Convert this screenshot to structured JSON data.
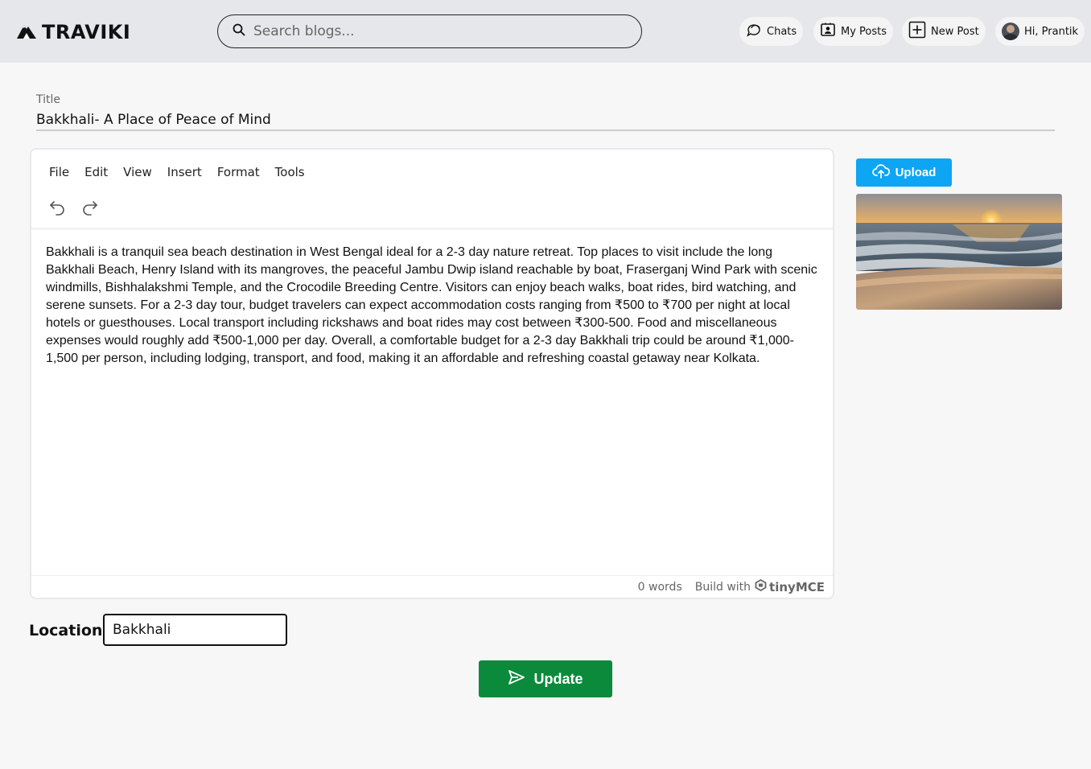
{
  "header": {
    "logo_text": "TRAVIKI",
    "search_placeholder": "Search blogs...",
    "nav": {
      "chats": "Chats",
      "my_posts": "My Posts",
      "new_post": "New Post",
      "greeting": "Hi, Prantik"
    }
  },
  "form": {
    "title_label": "Title",
    "title_value": "Bakkhali- A Place of Peace of Mind",
    "location_label": "Location:",
    "location_value": "Bakkhali",
    "upload_label": "Upload",
    "update_label": "Update"
  },
  "editor": {
    "menu": [
      "File",
      "Edit",
      "View",
      "Insert",
      "Format",
      "Tools"
    ],
    "content": "Bakkhali is a tranquil sea beach destination in West Bengal ideal for a 2-3 day nature retreat. Top places to visit include the long Bakkhali Beach, Henry Island with its mangroves, the peaceful Jambu Dwip island reachable by boat, Fraserganj Wind Park with scenic windmills, Bishhalakshmi Temple, and the Crocodile Breeding Centre. Visitors can enjoy beach walks, boat rides, bird watching, and serene sunsets. For a 2-3 day tour, budget travelers can expect accommodation costs ranging from ₹500 to ₹700 per night at local hotels or guesthouses. Local transport including rickshaws and boat rides may cost between ₹300-500. Food and miscellaneous expenses would roughly add ₹500-1,000 per day. Overall, a comfortable budget for a 2-3 day Bakkhali trip could be around ₹1,000-1,500 per person, including lodging, transport, and food, making it an affordable and refreshing coastal getaway near Kolkata.",
    "word_count": "0 words",
    "build_with": "Build with",
    "tiny_brand": "tinyMCE"
  },
  "colors": {
    "header_bg": "#e6e7ea",
    "upload_blue": "#0ea5f4",
    "update_green": "#0a8a3a"
  },
  "icons": [
    "mountain-logo-icon",
    "search-icon",
    "chat-icon",
    "profile-card-icon",
    "plus-square-icon",
    "avatar",
    "undo-icon",
    "redo-icon",
    "cloud-upload-icon",
    "send-icon",
    "tinymce-logo-icon"
  ]
}
